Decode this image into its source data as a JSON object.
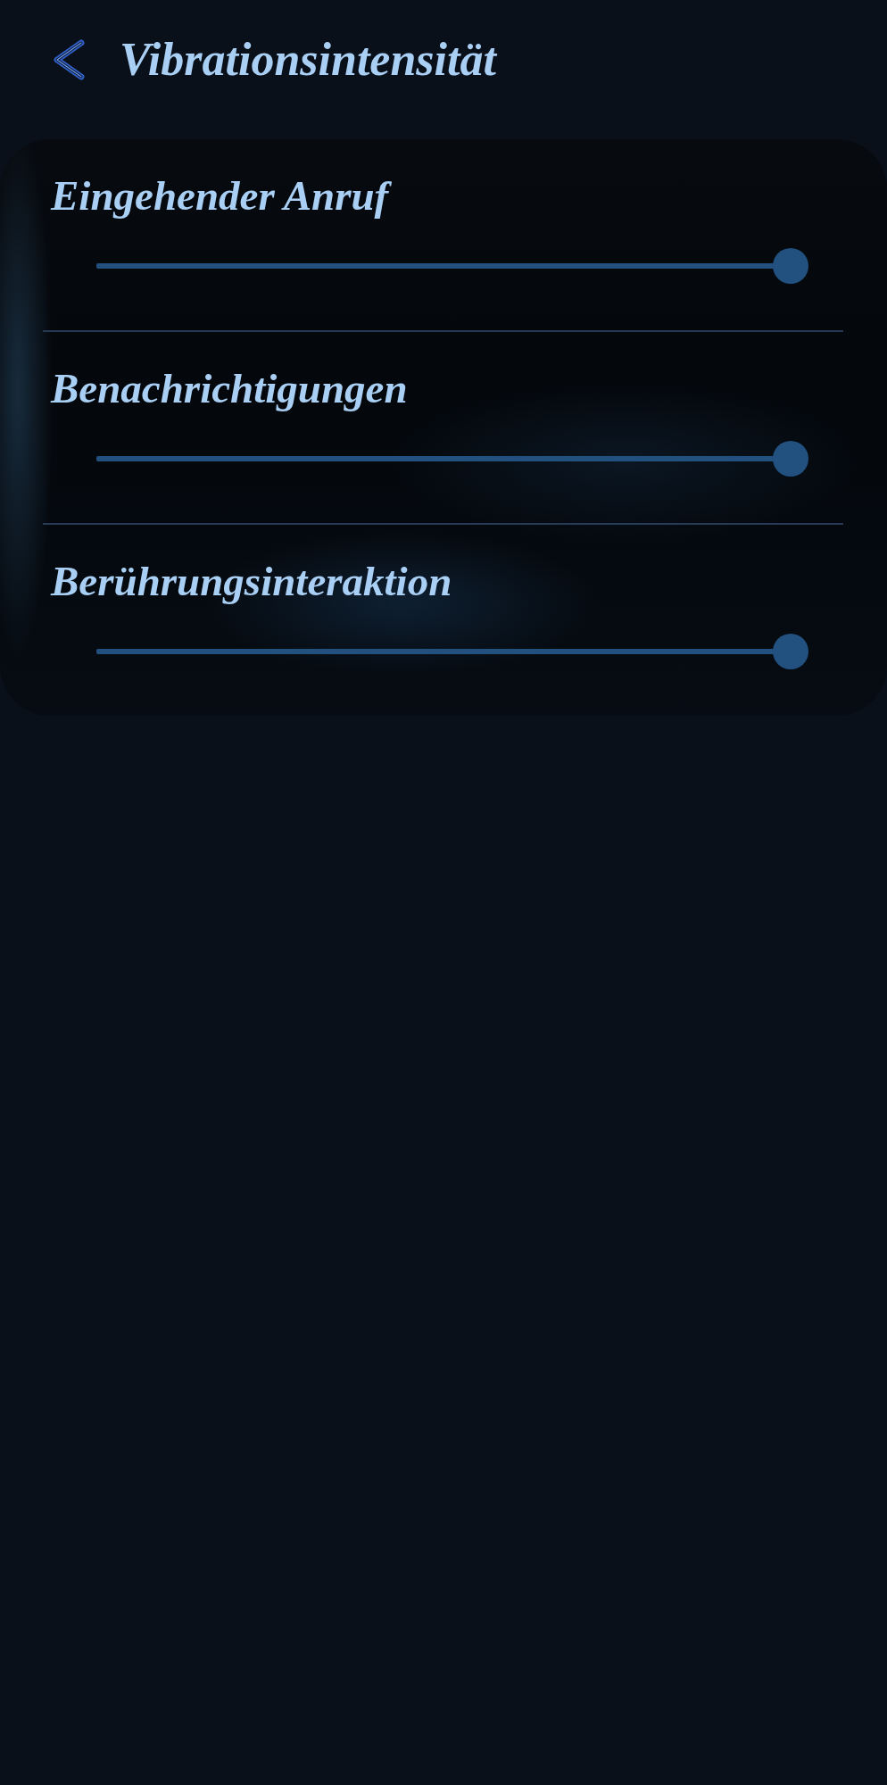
{
  "header": {
    "title": "Vibrationsintensität"
  },
  "rows": [
    {
      "label": "Eingehender Anruf",
      "level": 1
    },
    {
      "label": "Benachrichtigungen",
      "level": 1
    },
    {
      "label": "Berührungsinteraktion",
      "level": 1
    }
  ]
}
